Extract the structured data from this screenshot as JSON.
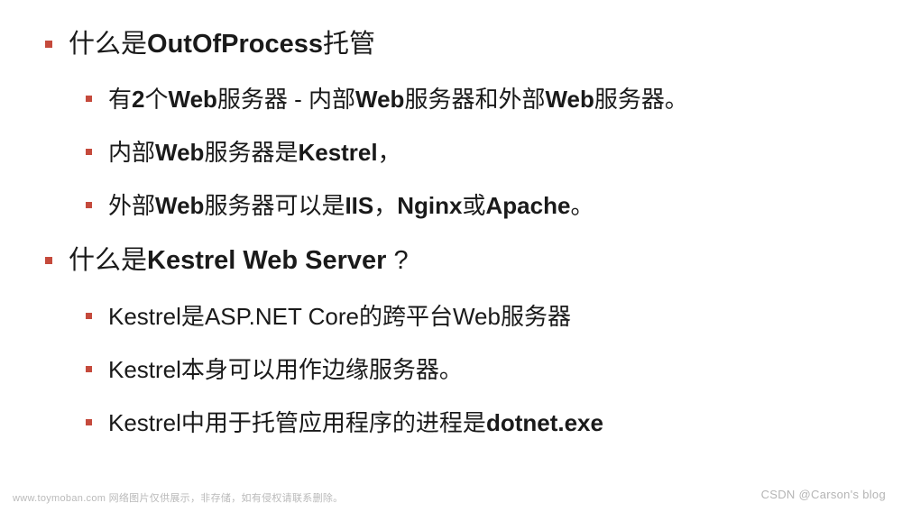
{
  "items": [
    {
      "level": 1,
      "parts": [
        {
          "text": "什么是",
          "bold": false
        },
        {
          "text": "OutOfProcess",
          "bold": true
        },
        {
          "text": "托管",
          "bold": false
        }
      ]
    },
    {
      "level": 2,
      "parts": [
        {
          "text": "有",
          "bold": false
        },
        {
          "text": "2",
          "bold": true
        },
        {
          "text": "个",
          "bold": false
        },
        {
          "text": "Web",
          "bold": true
        },
        {
          "text": "服务器 - 内部",
          "bold": false
        },
        {
          "text": "Web",
          "bold": true
        },
        {
          "text": "服务器和外部",
          "bold": false
        },
        {
          "text": "Web",
          "bold": true
        },
        {
          "text": "服务器。",
          "bold": false
        }
      ]
    },
    {
      "level": 2,
      "parts": [
        {
          "text": "内部",
          "bold": false
        },
        {
          "text": "Web",
          "bold": true
        },
        {
          "text": "服务器是",
          "bold": false
        },
        {
          "text": "Kestrel",
          "bold": true
        },
        {
          "text": "，",
          "bold": false
        }
      ]
    },
    {
      "level": 2,
      "parts": [
        {
          "text": "外部",
          "bold": false
        },
        {
          "text": "Web",
          "bold": true
        },
        {
          "text": "服务器可以是",
          "bold": false
        },
        {
          "text": "IIS",
          "bold": true
        },
        {
          "text": "，",
          "bold": false
        },
        {
          "text": "Nginx",
          "bold": true
        },
        {
          "text": "或",
          "bold": false
        },
        {
          "text": "Apache",
          "bold": true
        },
        {
          "text": "。",
          "bold": false
        }
      ]
    },
    {
      "level": 1,
      "parts": [
        {
          "text": "什么是",
          "bold": false
        },
        {
          "text": "Kestrel Web Server",
          "bold": true
        },
        {
          "text": " ?",
          "bold": false
        }
      ]
    },
    {
      "level": 2,
      "parts": [
        {
          "text": "Kestrel",
          "bold": false
        },
        {
          "text": "是",
          "bold": false
        },
        {
          "text": "ASP.NET Core",
          "bold": false
        },
        {
          "text": "的跨平台",
          "bold": false
        },
        {
          "text": "Web",
          "bold": false
        },
        {
          "text": "服务器",
          "bold": false
        }
      ]
    },
    {
      "level": 2,
      "parts": [
        {
          "text": "Kestrel",
          "bold": false
        },
        {
          "text": "本身可以用作边缘服务器。",
          "bold": false
        }
      ]
    },
    {
      "level": 2,
      "parts": [
        {
          "text": "Kestrel",
          "bold": false
        },
        {
          "text": "中用于托管应用程序的进程是",
          "bold": false
        },
        {
          "text": "dotnet.exe",
          "bold": true
        }
      ]
    }
  ],
  "watermark_left": "www.toymoban.com 网络图片仅供展示，非存储，如有侵权请联系删除。",
  "watermark_right": "CSDN @Carson's  blog"
}
